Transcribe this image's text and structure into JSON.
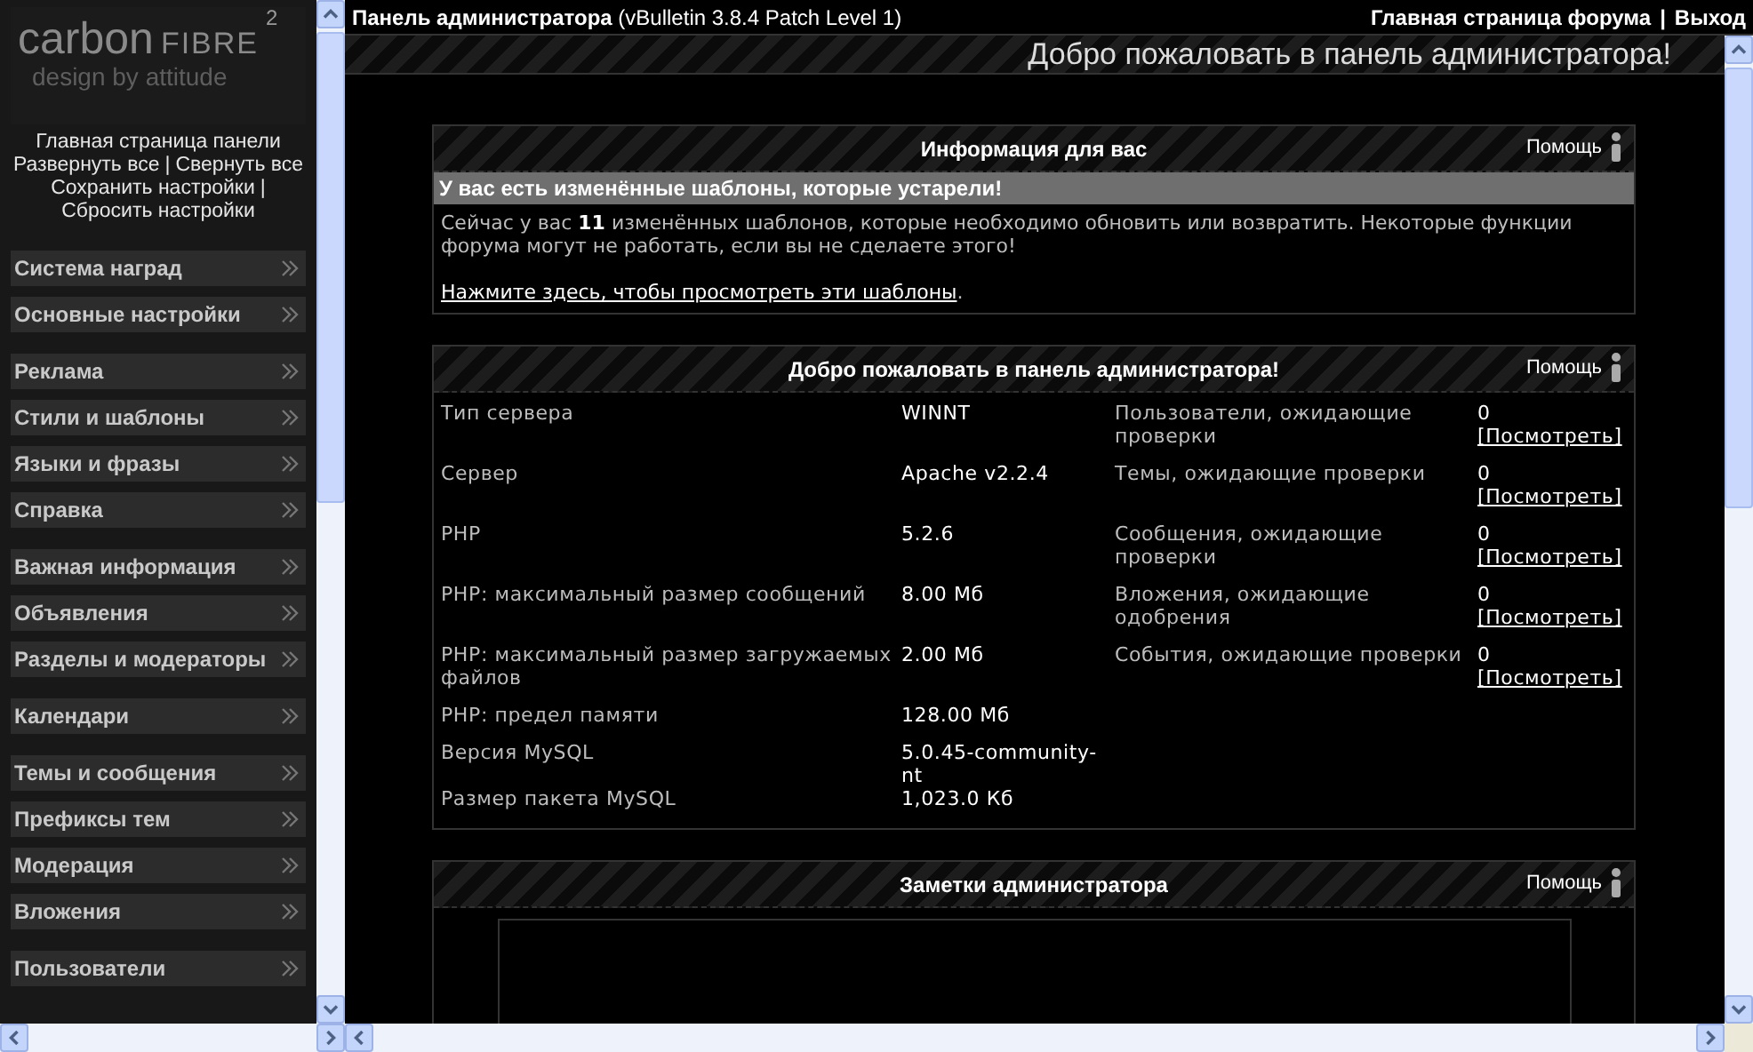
{
  "sidebar": {
    "logo": {
      "word1": "carbon",
      "word2": "FIBRE",
      "superscript": "2",
      "tagline": "design by attitude"
    },
    "lines": [
      [
        {
          "label": "Главная страница панели"
        }
      ],
      [
        {
          "label": "Развернуть все",
          "sep": "|"
        },
        {
          "label": "Свернуть все"
        }
      ],
      [
        {
          "label": "Сохранить настройки",
          "sep": "|"
        }
      ],
      [
        {
          "label": "Сбросить настройки"
        }
      ]
    ],
    "groups": [
      {
        "items": [
          {
            "label": "Система наград"
          },
          {
            "label": "Основные настройки"
          }
        ]
      },
      {
        "items": [
          {
            "label": "Реклама"
          },
          {
            "label": "Стили и шаблоны"
          },
          {
            "label": "Языки и фразы"
          },
          {
            "label": "Справка"
          }
        ]
      },
      {
        "items": [
          {
            "label": "Важная информация"
          },
          {
            "label": "Объявления"
          },
          {
            "label": "Разделы и модераторы"
          }
        ]
      },
      {
        "items": [
          {
            "label": "Календари"
          }
        ]
      },
      {
        "items": [
          {
            "label": "Темы и сообщения"
          },
          {
            "label": "Префиксы тем"
          },
          {
            "label": "Модерация"
          },
          {
            "label": "Вложения"
          }
        ]
      },
      {
        "items": [
          {
            "label": "Пользователи"
          }
        ]
      }
    ]
  },
  "topbar": {
    "title": "Панель администратора",
    "version": "(vBulletin 3.8.4 Patch Level 1)",
    "links": [
      {
        "label": "Главная страница форума",
        "sep": "|"
      },
      {
        "label": "Выход"
      }
    ]
  },
  "main": {
    "heading": "Добро пожаловать в панель администратора!",
    "panels": [
      {
        "kind": "notice",
        "title": "Информация для вас",
        "help": "Помощь",
        "alert": "У вас есть изменённые шаблоны, которые устарели!",
        "message": "Сейчас у вас **11** изменённых шаблонов, которые необходимо обновить или возвратить. Некоторые функции форума могут не работать, если вы не сделаете этого!",
        "link": "Нажмите здесь, чтобы просмотреть эти шаблоны",
        "link_suffix": "."
      },
      {
        "kind": "stats",
        "title": "Добро пожаловать в панель администратора!",
        "help": "Помощь",
        "server_info": [
          {
            "label": "Тип сервера",
            "value": "WINNT"
          },
          {
            "label": "Сервер",
            "value": "Apache v2.2.4"
          },
          {
            "label": "PHP",
            "value": "5.2.6"
          },
          {
            "label": "PHP: максимальный размер сообщений",
            "value": "8.00 Мб"
          },
          {
            "label": "PHP: максимальный размер загружаемых файлов",
            "value": "2.00 Мб"
          },
          {
            "label": "PHP: предел памяти",
            "value": "128.00 Мб"
          },
          {
            "label": "Версия MySQL",
            "value": "5.0.45-community-nt"
          },
          {
            "label": "Размер пакета MySQL",
            "value": "1,023.0 Кб"
          }
        ],
        "moderation": [
          {
            "label": "Пользователи, ожидающие проверки",
            "count": "0",
            "action": "[Посмотреть]"
          },
          {
            "label": "Темы, ожидающие проверки",
            "count": "0",
            "action": "[Посмотреть]"
          },
          {
            "label": "Сообщения, ожидающие проверки",
            "count": "0",
            "action": "[Посмотреть]"
          },
          {
            "label": "Вложения, ожидающие одобрения",
            "count": "0",
            "action": "[Посмотреть]"
          },
          {
            "label": "События, ожидающие проверки",
            "count": "0",
            "action": "[Посмотреть]"
          }
        ]
      },
      {
        "kind": "notes",
        "title": "Заметки администратора",
        "help": "Помощь"
      }
    ]
  }
}
